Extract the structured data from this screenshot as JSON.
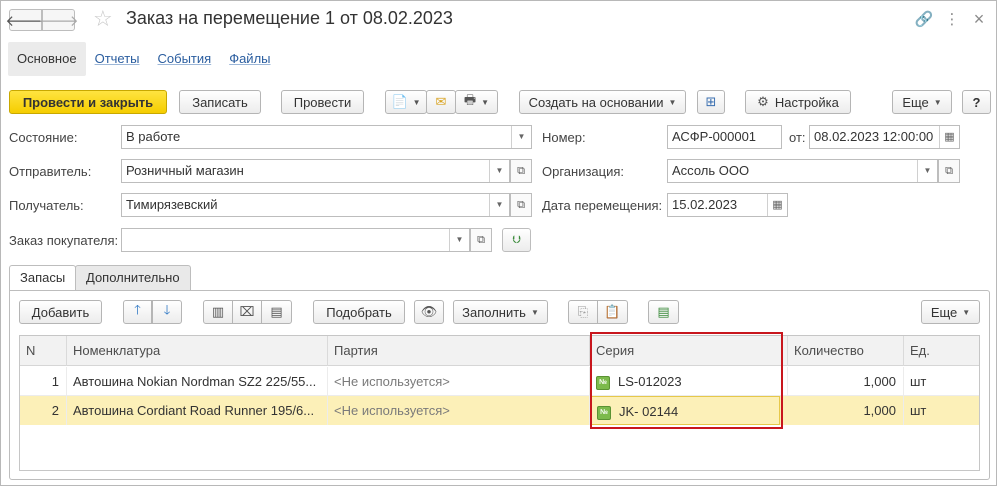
{
  "window": {
    "title": "Заказ на перемещение 1 от 08.02.2023",
    "back_icon": "arrow-left-icon",
    "forward_icon": "arrow-right-icon",
    "favorite_icon": "star-icon",
    "link_icon": "link-icon",
    "more_icon": "vertical-dots-icon",
    "maximize_icon": "square-icon",
    "close_icon": "close-icon"
  },
  "sections": {
    "main": "Основное",
    "reports": "Отчеты",
    "events": "События",
    "files": "Файлы"
  },
  "toolbar": {
    "post_close": "Провести и закрыть",
    "save": "Записать",
    "post": "Провести",
    "create_based": "Создать на основании",
    "settings": "Настройка",
    "more": "Еще",
    "help": "?"
  },
  "form": {
    "state_label": "Состояние:",
    "state_value": "В работе",
    "sender_label": "Отправитель:",
    "sender_value": "Розничный магазин",
    "receiver_label": "Получатель:",
    "receiver_value": "Тимирязевский",
    "customer_order_label": "Заказ покупателя:",
    "customer_order_value": "",
    "number_label": "Номер:",
    "number_value": "АСФР-000001",
    "from_label": "от:",
    "from_value": "08.02.2023 12:00:00",
    "org_label": "Организация:",
    "org_value": "Ассоль ООО",
    "move_date_label": "Дата перемещения:",
    "move_date_value": "15.02.2023"
  },
  "tabs": {
    "stock": "Запасы",
    "additional": "Дополнительно"
  },
  "table_toolbar": {
    "add": "Добавить",
    "pick": "Подобрать",
    "fill": "Заполнить",
    "more": "Еще"
  },
  "table": {
    "columns": [
      "N",
      "Номенклатура",
      "Партия",
      "Серия",
      "Количество",
      "Ед."
    ],
    "rows": [
      {
        "n": "1",
        "item": "Автошина Nokian Nordman SZ2 225/55...",
        "batch": "<Не используется>",
        "series": "LS-012023",
        "qty": "1,000",
        "unit": "шт"
      },
      {
        "n": "2",
        "item": "Автошина Cordiant Road Runner 195/6...",
        "batch": "<Не используется>",
        "series": "JK- 02144",
        "qty": "1,000",
        "unit": "шт"
      }
    ]
  },
  "colors": {
    "primary_button": "#f5cd00",
    "selected_row": "#fcf0b8",
    "highlight_box": "#c8161d",
    "link": "#2a5d9f"
  }
}
